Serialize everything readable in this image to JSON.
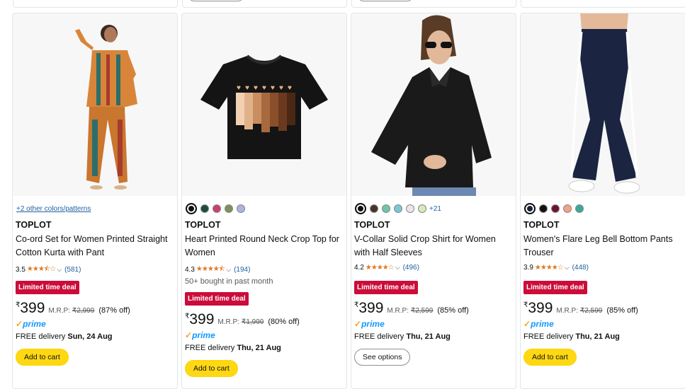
{
  "products": [
    {
      "colors_link": "+2 other colors/patterns",
      "brand": "TOPLOT",
      "title": "Co-ord Set for Women Printed Straight Cotton Kurta with Pant",
      "rating": "3.5",
      "stars": "★★★⯪☆",
      "reviews": "(581)",
      "deal": "Limited time deal",
      "currency": "₹",
      "price": "399",
      "mrp_label": "M.R.P:",
      "mrp": "₹2,999",
      "discount": "(87% off)",
      "prime": "prime",
      "delivery_label": "FREE delivery",
      "delivery_date": "Sun, 24 Aug",
      "button": "Add to cart"
    },
    {
      "brand": "TOPLOT",
      "title": "Heart Printed Round Neck Crop Top for Women",
      "rating": "4.3",
      "stars": "★★★★⯪",
      "reviews": "(194)",
      "bought": "50+ bought in past month",
      "deal": "Limited time deal",
      "currency": "₹",
      "price": "399",
      "mrp_label": "M.R.P:",
      "mrp": "₹1,999",
      "discount": "(80% off)",
      "prime": "prime",
      "delivery_label": "FREE delivery",
      "delivery_date": "Thu, 21 Aug",
      "button": "Add to cart",
      "swatch_colors": [
        "#111111",
        "#1e4d3a",
        "#c9426a",
        "#7f8f5a",
        "#aab3e3"
      ]
    },
    {
      "brand": "TOPLOT",
      "title": "V-Collar Solid Crop Shirt for Women with Half Sleeves",
      "rating": "4.2",
      "stars": "★★★★☆",
      "reviews": "(496)",
      "deal": "Limited time deal",
      "currency": "₹",
      "price": "399",
      "mrp_label": "M.R.P:",
      "mrp": "₹2,599",
      "discount": "(85% off)",
      "prime": "prime",
      "delivery_label": "FREE delivery",
      "delivery_date": "Thu, 21 Aug",
      "button": "See options",
      "swatch_colors": [
        "#111111",
        "#4a3427",
        "#6fc5a8",
        "#7cc6d9",
        "#ece6ec",
        "#d9e9b9"
      ],
      "more_colors": "+21"
    },
    {
      "brand": "TOPLOT",
      "title": "Women's Flare Leg Bell Bottom Pants Trouser",
      "rating": "3.9",
      "stars": "★★★★☆",
      "reviews": "(448)",
      "deal": "Limited time deal",
      "currency": "₹",
      "price": "399",
      "mrp_label": "M.R.P:",
      "mrp": "₹2,599",
      "discount": "(85% off)",
      "prime": "prime",
      "delivery_label": "FREE delivery",
      "delivery_date": "Thu, 21 Aug",
      "button": "Add to cart",
      "swatch_colors": [
        "#1a2236",
        "#111111",
        "#6e1230",
        "#f4a08a",
        "#3aa99a"
      ]
    }
  ],
  "colors": {
    "deal_red": "#cc0c39",
    "link_blue": "#2162a1",
    "star_orange": "#de7921",
    "button_yellow": "#ffd814",
    "prime_blue": "#1399ff"
  }
}
